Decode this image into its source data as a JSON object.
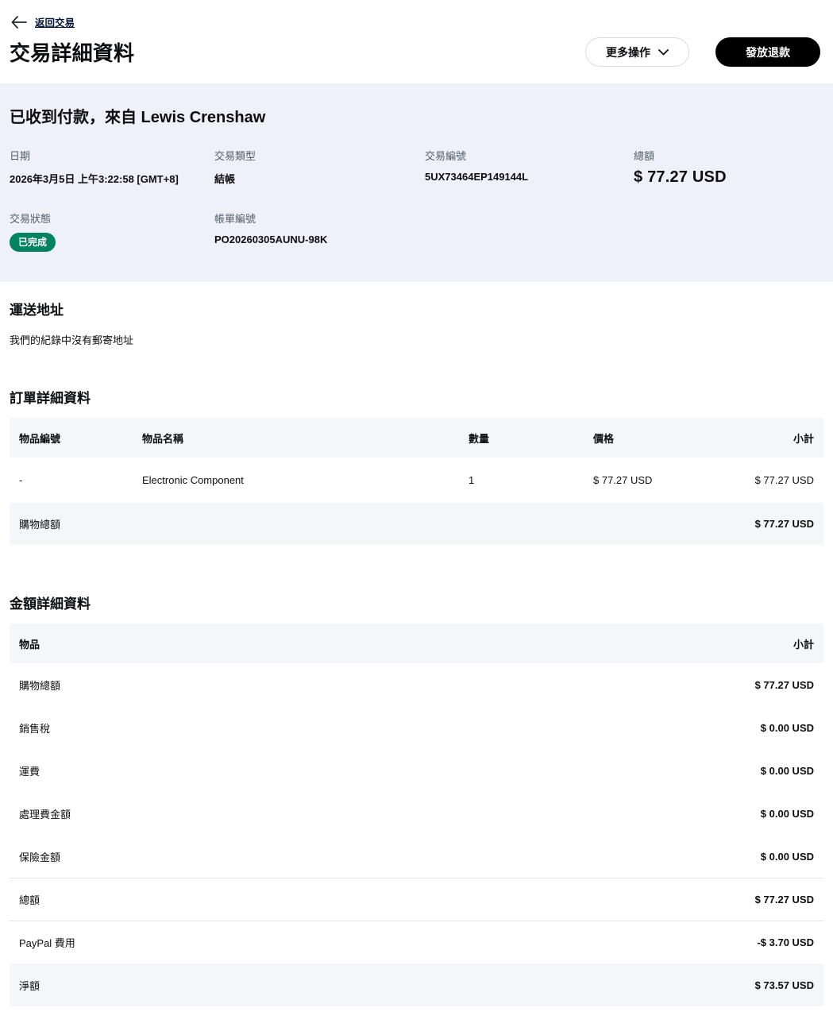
{
  "page": {
    "back_link": "返回交易",
    "title": "交易詳細資料",
    "more_actions_label": "更多操作",
    "refund_button_label": "發放退款"
  },
  "summary": {
    "heading": "已收到付款，來自 Lewis Crenshaw",
    "fields": [
      {
        "label": "日期",
        "value": "2026年3月5日 上午3:22:58 [GMT+8]"
      },
      {
        "label": "交易類型",
        "value": "結帳"
      },
      {
        "label": "交易編號",
        "value": "5UX73464EP149144L"
      },
      {
        "label": "總額",
        "value": "$ 77.27 USD"
      }
    ],
    "status_label": "交易狀態",
    "status_value": "已完成",
    "invoice_label": "帳單編號",
    "invoice_value": "PO20260305AUNU-98K"
  },
  "shipping": {
    "heading": "運送地址",
    "text": "我們的紀錄中沒有郵寄地址"
  },
  "order": {
    "heading": "訂單詳細資料",
    "columns": [
      "物品編號",
      "物品名稱",
      "數量",
      "價格",
      "小計"
    ],
    "rows": [
      {
        "item_id": "-",
        "item_name": "Electronic Component",
        "qty": "1",
        "price": "$ 77.27 USD",
        "subtotal": "$ 77.27 USD"
      }
    ],
    "footer": {
      "label": "購物總額",
      "value": "$ 77.27 USD"
    }
  },
  "amounts": {
    "heading": "金額詳細資料",
    "columns": [
      "物品",
      "小計"
    ],
    "rows": [
      {
        "label": "購物總額",
        "value": "$ 77.27 USD"
      },
      {
        "label": "銷售稅",
        "value": "$ 0.00 USD"
      },
      {
        "label": "運費",
        "value": "$ 0.00 USD"
      },
      {
        "label": "處理費金額",
        "value": "$ 0.00 USD"
      },
      {
        "label": "保險金額",
        "value": "$ 0.00 USD"
      },
      {
        "label": "總額",
        "value": "$ 77.27 USD"
      },
      {
        "label": "PayPal 費用",
        "value": "-$ 3.70 USD"
      },
      {
        "label": "淨額",
        "value": "$ 73.57 USD"
      }
    ]
  },
  "colors": {
    "status_green": "#00835f",
    "primary_button_black": "#000000",
    "panel_background": "#eef1f8",
    "table_header_background": "#f5f6fa",
    "label_gray": "#545d68"
  }
}
